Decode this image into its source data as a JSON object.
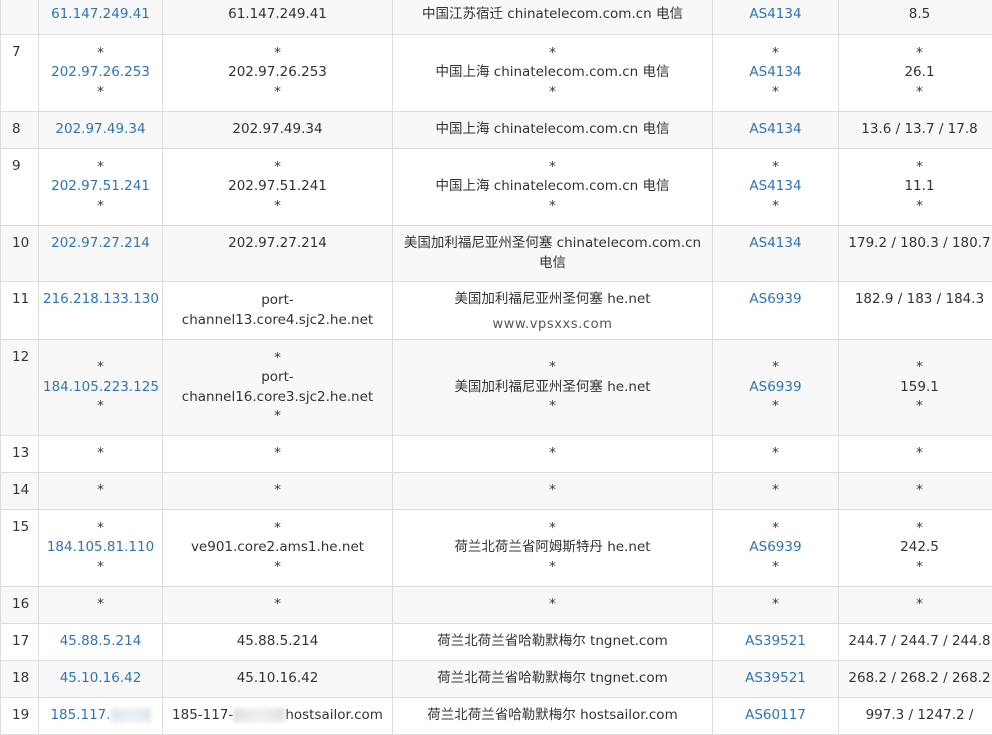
{
  "watermark": "www.vpsxxs.com",
  "rows": [
    {
      "hop": "",
      "ip": [
        "61.147.249.41"
      ],
      "host": [
        "61.147.249.41"
      ],
      "loc": [
        "中国江苏宿迁 chinatelecom.com.cn 电信"
      ],
      "asn": [
        "AS4134"
      ],
      "lat": [
        "8.5"
      ]
    },
    {
      "hop": "7",
      "ip": [
        "*",
        "202.97.26.253",
        "*"
      ],
      "host": [
        "*",
        "202.97.26.253",
        "*"
      ],
      "loc": [
        "*",
        "中国上海 chinatelecom.com.cn 电信",
        "*"
      ],
      "asn": [
        "*",
        "AS4134",
        "*"
      ],
      "lat": [
        "*",
        "26.1",
        "*"
      ]
    },
    {
      "hop": "8",
      "ip": [
        "202.97.49.34"
      ],
      "host": [
        "202.97.49.34"
      ],
      "loc": [
        "中国上海 chinatelecom.com.cn 电信"
      ],
      "asn": [
        "AS4134"
      ],
      "lat": [
        "13.6 / 13.7 / 17.8"
      ]
    },
    {
      "hop": "9",
      "ip": [
        "*",
        "202.97.51.241",
        "*"
      ],
      "host": [
        "*",
        "202.97.51.241",
        "*"
      ],
      "loc": [
        "*",
        "中国上海 chinatelecom.com.cn 电信",
        "*"
      ],
      "asn": [
        "*",
        "AS4134",
        "*"
      ],
      "lat": [
        "*",
        "11.1",
        "*"
      ]
    },
    {
      "hop": "10",
      "ip": [
        "202.97.27.214"
      ],
      "host": [
        "202.97.27.214"
      ],
      "loc": [
        "美国加利福尼亚州圣何塞 chinatelecom.com.cn",
        "电信"
      ],
      "asn": [
        "AS4134"
      ],
      "lat": [
        "179.2 / 180.3 / 180.7"
      ]
    },
    {
      "hop": "11",
      "ip": [
        "216.218.133.130"
      ],
      "host": [
        "port-",
        "channel13.core4.sjc2.he.net"
      ],
      "loc": [
        "美国加利福尼亚州圣何塞 he.net"
      ],
      "asn": [
        "AS6939"
      ],
      "lat": [
        "182.9 / 183 / 184.3"
      ]
    },
    {
      "hop": "12",
      "ip": [
        "*",
        "184.105.223.125",
        "*"
      ],
      "host": [
        "*",
        "port-",
        "channel16.core3.sjc2.he.net",
        "*"
      ],
      "loc": [
        "*",
        "美国加利福尼亚州圣何塞 he.net",
        "*"
      ],
      "asn": [
        "*",
        "AS6939",
        "*"
      ],
      "lat": [
        "*",
        "159.1",
        "*"
      ]
    },
    {
      "hop": "13",
      "ip": [
        "*"
      ],
      "host": [
        "*"
      ],
      "loc": [
        "*"
      ],
      "asn": [
        "*"
      ],
      "lat": [
        "*"
      ]
    },
    {
      "hop": "14",
      "ip": [
        "*"
      ],
      "host": [
        "*"
      ],
      "loc": [
        "*"
      ],
      "asn": [
        "*"
      ],
      "lat": [
        "*"
      ]
    },
    {
      "hop": "15",
      "ip": [
        "*",
        "184.105.81.110",
        "*"
      ],
      "host": [
        "*",
        "ve901.core2.ams1.he.net",
        "*"
      ],
      "loc": [
        "*",
        "荷兰北荷兰省阿姆斯特丹 he.net",
        "*"
      ],
      "asn": [
        "*",
        "AS6939",
        "*"
      ],
      "lat": [
        "*",
        "242.5",
        "*"
      ]
    },
    {
      "hop": "16",
      "ip": [
        "*"
      ],
      "host": [
        "*"
      ],
      "loc": [
        "*"
      ],
      "asn": [
        "*"
      ],
      "lat": [
        "*"
      ]
    },
    {
      "hop": "17",
      "ip": [
        "45.88.5.214"
      ],
      "host": [
        "45.88.5.214"
      ],
      "loc": [
        "荷兰北荷兰省哈勒默梅尔 tngnet.com"
      ],
      "asn": [
        "AS39521"
      ],
      "lat": [
        "244.7 / 244.7 / 244.8"
      ]
    },
    {
      "hop": "18",
      "ip": [
        "45.10.16.42"
      ],
      "host": [
        "45.10.16.42"
      ],
      "loc": [
        "荷兰北荷兰省哈勒默梅尔 tngnet.com"
      ],
      "asn": [
        "AS39521"
      ],
      "lat": [
        "268.2 / 268.2 / 268.2"
      ]
    },
    {
      "hop": "19",
      "ip": [
        "185.117."
      ],
      "host": [
        "185-117-",
        "hostsailor.com"
      ],
      "loc": [
        "荷兰北荷兰省哈勒默梅尔 hostsailor.com"
      ],
      "asn": [
        "AS60117"
      ],
      "lat": [
        "997.3 / 1247.2 /"
      ]
    }
  ]
}
